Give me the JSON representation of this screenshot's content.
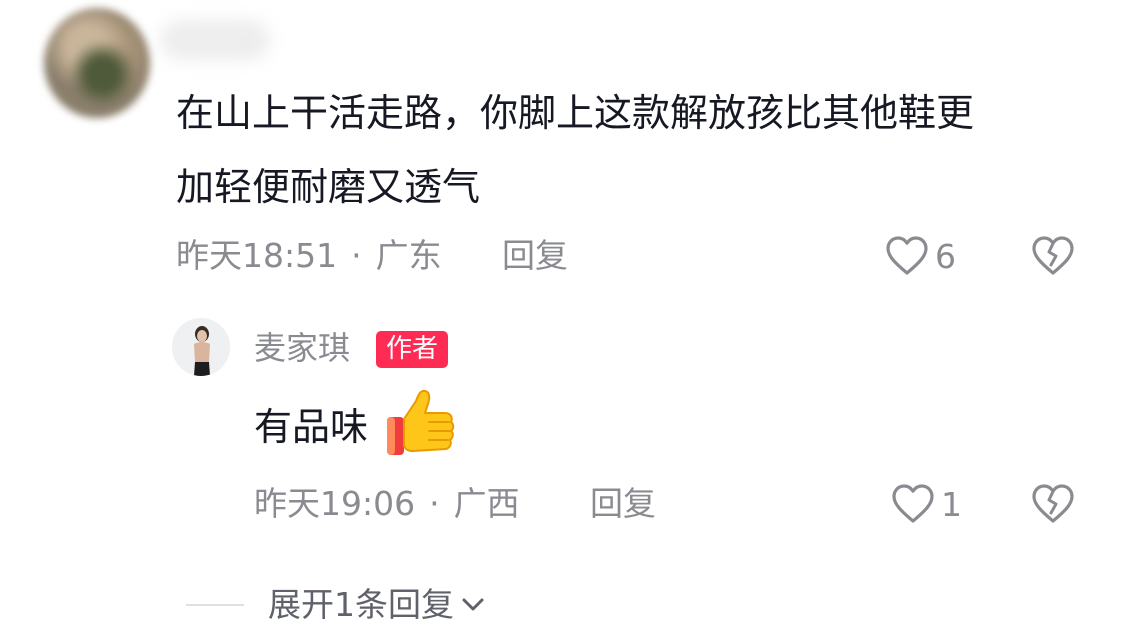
{
  "comment": {
    "text_line1": "在山上干活走路，你脚上这款解放孩比其他鞋更",
    "text_line2": "加轻便耐磨又透气",
    "time": "昨天18:51",
    "separator": "·",
    "location": "广东",
    "reply_label": "回复",
    "like_count": "6"
  },
  "reply": {
    "author": "麦家琪",
    "badge": "作者",
    "text": "有品味",
    "emoji": "thumbs-up-emoji",
    "time": "昨天19:06",
    "separator": "·",
    "location": "广西",
    "reply_label": "回复",
    "like_count": "1"
  },
  "expand": {
    "label": "展开1条回复",
    "icon": "chevron-down-icon"
  },
  "icons": {
    "like": "heart-outline-icon",
    "dislike": "broken-heart-outline-icon"
  },
  "colors": {
    "text_primary": "#161823",
    "text_secondary": "#8a8b91",
    "badge_bg": "#fe2c55"
  }
}
